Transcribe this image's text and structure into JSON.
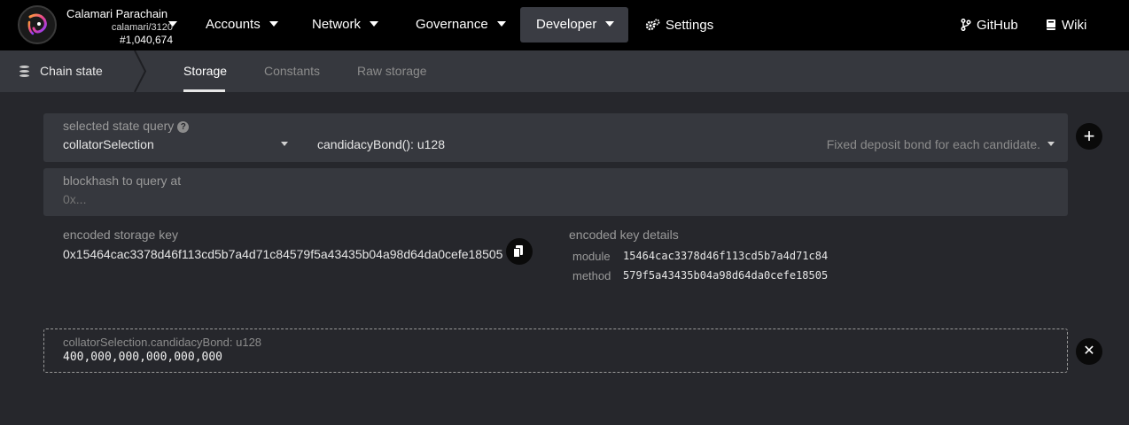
{
  "header": {
    "chain_name": "Calamari Parachain",
    "chain_spec": "calamari/3120",
    "block_number": "#1,040,674",
    "logo_icon": "calamari-logo-icon",
    "nav": [
      {
        "label": "Accounts",
        "has_caret": true
      },
      {
        "label": "Network",
        "has_caret": true
      },
      {
        "label": "Governance",
        "has_caret": true
      },
      {
        "label": "Developer",
        "has_caret": true,
        "active": true
      },
      {
        "label": "Settings",
        "icon": "gears-icon"
      }
    ],
    "links": [
      {
        "label": "GitHub",
        "icon": "git-branch-icon"
      },
      {
        "label": "Wiki",
        "icon": "book-icon"
      }
    ]
  },
  "subnav": {
    "section_title": "Chain state",
    "section_icon": "database-icon",
    "tabs": [
      {
        "label": "Storage",
        "active": true
      },
      {
        "label": "Constants"
      },
      {
        "label": "Raw storage"
      }
    ]
  },
  "query": {
    "label": "selected state query",
    "module": "collatorSelection",
    "method": "candidacyBond(): u128",
    "description": "Fixed deposit bond for each candidate."
  },
  "blockhash": {
    "label": "blockhash to query at",
    "placeholder": "0x..."
  },
  "encoded": {
    "key_label": "encoded storage key",
    "key_value": "0x15464cac3378d46f113cd5b7a4d71c84579f5a43435b04a98d64da0cefe18505",
    "details_label": "encoded key details",
    "module_label": "module",
    "module_value": "15464cac3378d46f113cd5b7a4d71c84",
    "method_label": "method",
    "method_value": "579f5a43435b04a98d64da0cefe18505"
  },
  "result": {
    "label": "collatorSelection.candidacyBond: u128",
    "value": "400,000,000,000,000,000"
  },
  "buttons": {
    "add": "+",
    "close": "✕"
  },
  "colors": {
    "topbar": "#000000",
    "background": "#26272c",
    "panel": "#36383e",
    "active_nav": "#3a3c43"
  }
}
